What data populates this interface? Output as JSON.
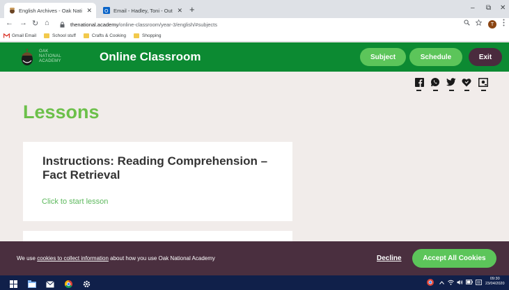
{
  "browser": {
    "tabs": [
      {
        "title": "English Archives - Oak National A",
        "close": "✕"
      },
      {
        "title": "Email - Hadley, Toni - Outlook",
        "close": "✕"
      }
    ],
    "new_tab": "+",
    "window_controls": {
      "minimize": "–",
      "maximize": "⧉",
      "close": "✕"
    },
    "nav": {
      "back": "←",
      "forward": "→",
      "reload": "↻",
      "home": "⌂"
    },
    "url": {
      "host": "thenational.academy",
      "path": "/online-classroom/year-3/english/#subjects"
    },
    "profile_initial": "T",
    "bookmarks": [
      {
        "label": "Gmail Email"
      },
      {
        "label": "School stuff"
      },
      {
        "label": "Crafts & Cooking"
      },
      {
        "label": "Shopping"
      }
    ]
  },
  "header": {
    "logo_lines": [
      "OAK",
      "NATIONAL",
      "ACADEMY"
    ],
    "title": "Online Classroom",
    "buttons": {
      "subject": "Subject",
      "schedule": "Schedule",
      "exit": "Exit"
    }
  },
  "main": {
    "heading": "Lessons",
    "lesson_card": {
      "title": "Instructions: Reading Comprehension – Fact Retrieval",
      "link": "Click to start lesson"
    }
  },
  "cookie_banner": {
    "text_before": "We use ",
    "link": "cookies to collect information",
    "text_after": " about how you use Oak National Academy",
    "decline": "Decline",
    "accept": "Accept All Cookies"
  },
  "taskbar": {
    "time": "09:30",
    "date": "23/04/2020"
  },
  "colors": {
    "header_green": "#0c8a32",
    "button_green": "#5cc55a",
    "exit_plum": "#4a2b3e",
    "lessons_green": "#6cc04a",
    "cookie_bg": "#4a2f3f",
    "page_bg": "#f1ecea"
  }
}
